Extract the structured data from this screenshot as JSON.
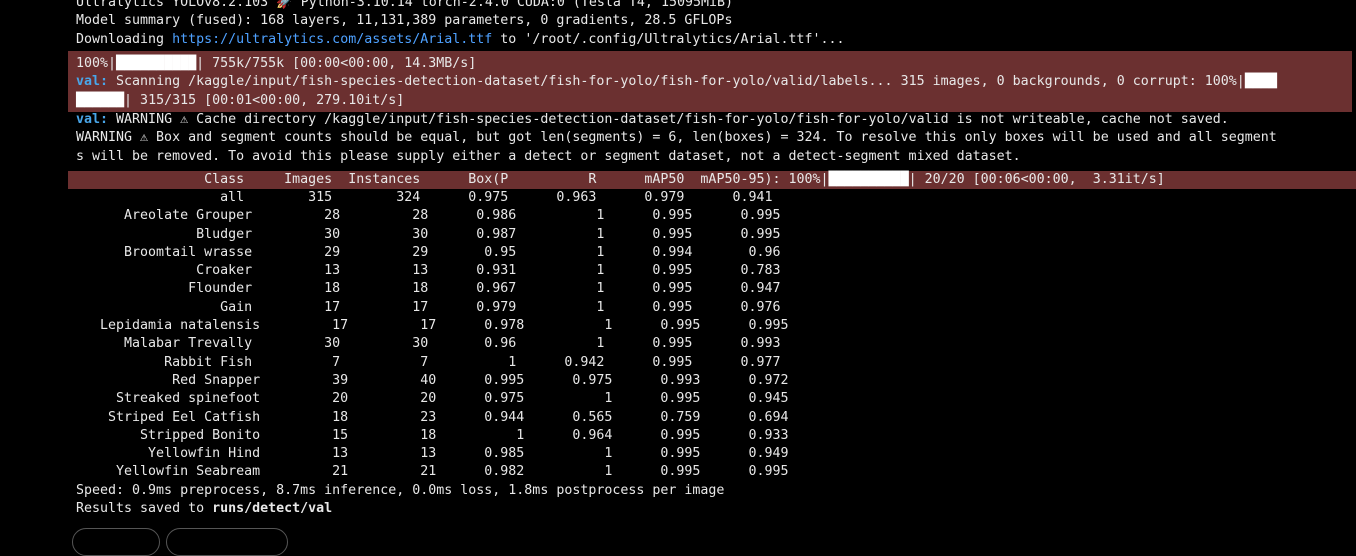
{
  "top": {
    "line1": "Ultralytics YOLOv8.2.103 🚀 Python-3.10.14 torch-2.4.0 CUDA:0 (Tesla T4, 15095MiB)",
    "line2": "Model summary (fused): 168 layers, 11,131,389 parameters, 0 gradients, 28.5 GFLOPs",
    "download_prefix": "Downloading ",
    "download_url": "https://ultralytics.com/assets/Arial.ttf",
    "download_suffix": " to '/root/.config/Ultralytics/Arial.ttf'..."
  },
  "progress": {
    "dl_pct": "100%|",
    "dl_bar": "██████████",
    "dl_rest": "| 755k/755k [00:00<00:00, 14.3MB/s]",
    "val_tag": "val:",
    "scan_text": " Scanning /kaggle/input/fish-species-detection-dataset/fish-for-yolo/fish-for-yolo/valid/labels... 315 images, 0 backgrounds, 0 corrupt: 100%|",
    "scan_bar1": "████",
    "scan_bar2": "██████",
    "scan_rest": "| 315/315 [00:01<00:00, 279.10it/s]"
  },
  "warnings": {
    "val_tag": "val:",
    "cache_warning": " WARNING ⚠ Cache directory /kaggle/input/fish-species-detection-dataset/fish-for-yolo/fish-for-yolo/valid is not writeable, cache not saved.",
    "segment_warning_1": "WARNING ⚠ Box and segment counts should be equal, but got len(segments) = 6, len(boxes) = 324. To resolve this only boxes will be used and all segment",
    "segment_warning_2": "s will be removed. To avoid this please supply either a detect or segment dataset, not a detect-segment mixed dataset."
  },
  "table": {
    "header_text": "                 Class     Images  Instances      Box(P          R      mAP50  mAP50-95): 100%|",
    "header_bar": "██████████",
    "header_rest": "| 20/20 [00:06<00:00,  3.31it/s]",
    "rows": [
      "                   all        315        324      0.975      0.963      0.979      0.941",
      "       Areolate Grouper         28         28      0.986          1      0.995      0.995",
      "                Bludger         30         30      0.987          1      0.995      0.995",
      "       Broomtail wrasse         29         29       0.95          1      0.994       0.96",
      "                Croaker         13         13      0.931          1      0.995      0.783",
      "               Flounder         18         18      0.967          1      0.995      0.947",
      "                   Gain         17         17      0.979          1      0.995      0.976",
      "    Lepidamia natalensis         17         17      0.978          1      0.995      0.995",
      "       Malabar Trevally         30         30       0.96          1      0.995      0.993",
      "            Rabbit Fish          7          7          1      0.942      0.995      0.977",
      "             Red Snapper         39         40      0.995      0.975      0.993      0.972",
      "      Streaked spinefoot         20         20      0.975          1      0.995      0.945",
      "     Striped Eel Catfish         18         23      0.944      0.565      0.759      0.694",
      "         Stripped Bonito         15         18          1      0.964      0.995      0.933",
      "          Yellowfin Hind         13         13      0.985          1      0.995      0.949",
      "      Yellowfin Seabream         21         21      0.982          1      0.995      0.995"
    ]
  },
  "footer": {
    "speed": "Speed: 0.9ms preprocess, 8.7ms inference, 0.0ms loss, 1.8ms postprocess per image",
    "results_prefix": "Results saved to ",
    "results_path": "runs/detect/val"
  }
}
